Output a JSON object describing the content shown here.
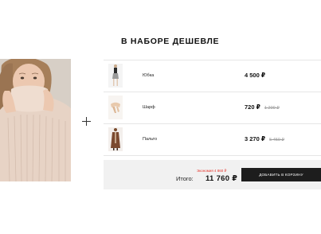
{
  "heading": "В НАБОРЕ ДЕШЕВЛЕ",
  "plus_icon": "plus-icon",
  "items": [
    {
      "name": "Юбка",
      "price": "4 500 ₽",
      "old_price": "",
      "thumb": "skirt-thumbnail"
    },
    {
      "name": "Шарф",
      "price": "720 ₽",
      "old_price": "1 200 ₽",
      "thumb": "scarf-thumbnail"
    },
    {
      "name": "Пальто",
      "price": "3 270 ₽",
      "old_price": "5 450 ₽",
      "thumb": "coat-thumbnail"
    }
  ],
  "summary": {
    "saving": "Экономия 4 860 ₽",
    "total_label": "Итого:",
    "total_value": "11 760 ₽",
    "cart_button": "ДОБАВИТЬ В КОРЗИНУ"
  },
  "colors": {
    "saving_red": "#e5332a",
    "button_bg": "#1d1d1d",
    "summary_bg": "#f1f1f1"
  }
}
